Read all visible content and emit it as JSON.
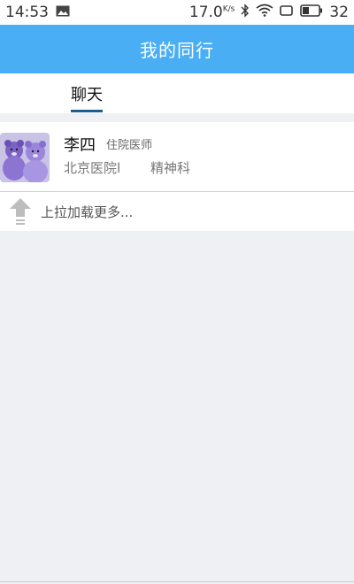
{
  "status": {
    "time": "14:53",
    "speed": "17.0",
    "speed_unit": "K/s",
    "battery": "32"
  },
  "header": {
    "title": "我的同行"
  },
  "tabs": [
    {
      "label": "聊天"
    }
  ],
  "colleagues": [
    {
      "name": "李四",
      "title": "住院医师",
      "hospital": "北京医院l",
      "department": "精神科"
    }
  ],
  "load_more": {
    "text": "上拉加载更多..."
  },
  "colors": {
    "accent": "#4aaef5",
    "tab_indicator": "#1b5e8c"
  }
}
